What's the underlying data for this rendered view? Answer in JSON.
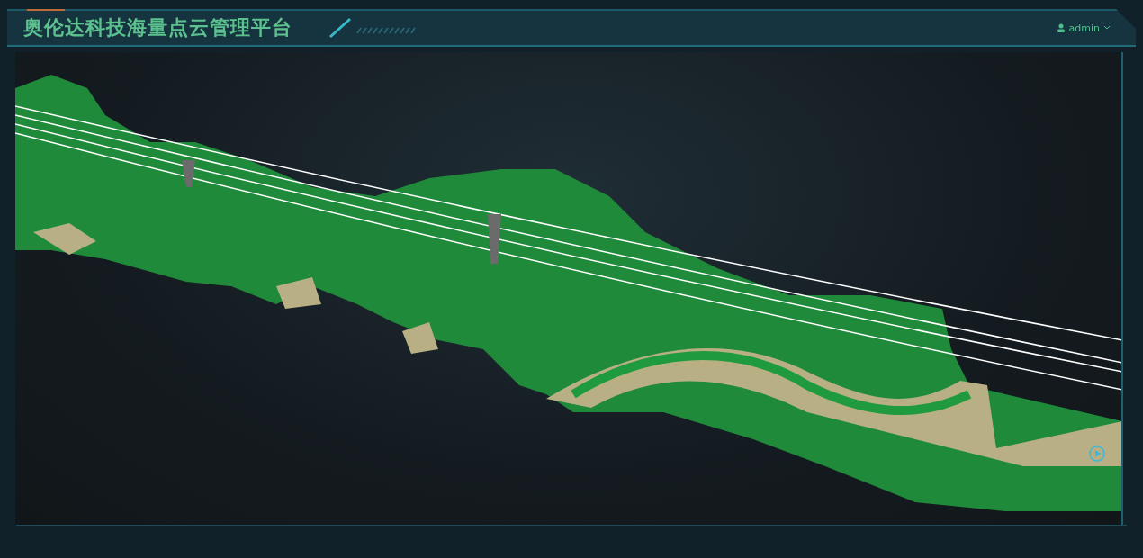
{
  "header": {
    "title": "奥伦达科技海量点云管理平台",
    "user": "admin"
  }
}
